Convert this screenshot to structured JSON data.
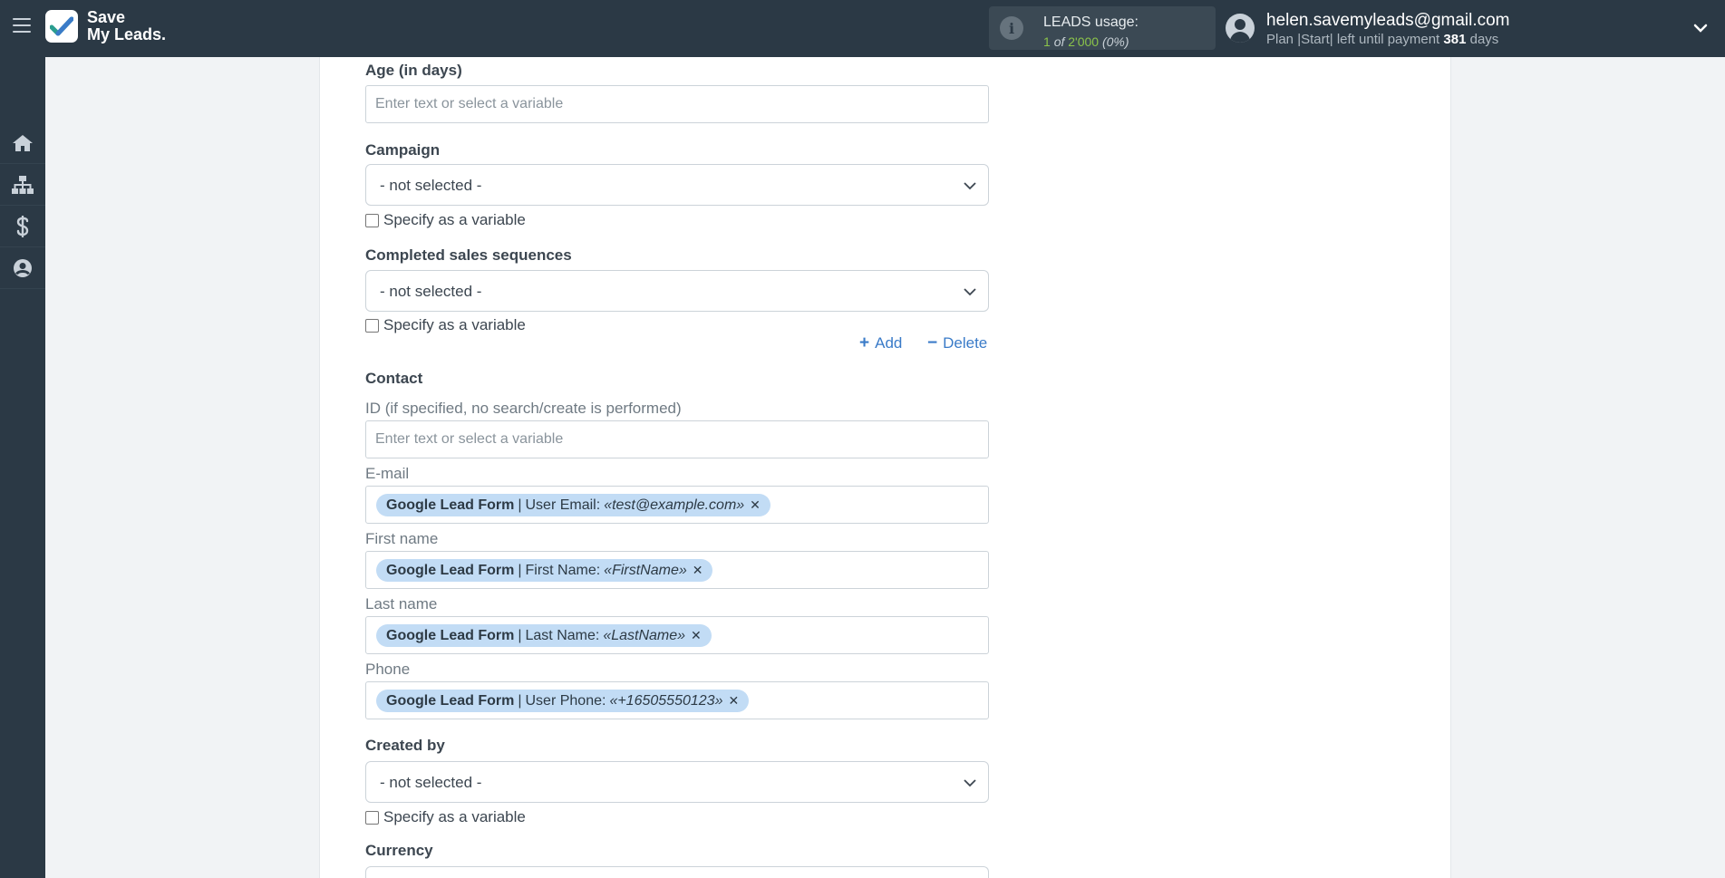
{
  "header": {
    "brand_line1": "Save",
    "brand_line2": "My Leads.",
    "usage_title": "LEADS usage:",
    "usage_used": "1",
    "usage_of": "of",
    "usage_total": "2'000",
    "usage_percent": "(0%)",
    "user_email": "helen.savemyleads@gmail.com",
    "plan_text": "Plan |Start| left until payment",
    "plan_days": "381",
    "plan_days_unit": "days"
  },
  "sidebar": {
    "items": [
      {
        "icon": "home-icon"
      },
      {
        "icon": "sitemap-icon"
      },
      {
        "icon": "dollar-icon"
      },
      {
        "icon": "account-icon"
      }
    ]
  },
  "form": {
    "age_label": "Age (in days)",
    "age_placeholder": "Enter text or select a variable",
    "campaign_label": "Campaign",
    "campaign_value": "- not selected -",
    "campaign_specify": "Specify as a variable",
    "sequences_label": "Completed sales sequences",
    "sequences_value": "- not selected -",
    "sequences_specify": "Specify as a variable",
    "add_label": "Add",
    "delete_label": "Delete",
    "contact_label": "Contact",
    "id_label": "ID (if specified, no search/create is performed)",
    "id_placeholder": "Enter text or select a variable",
    "email_label": "E-mail",
    "email_tag": {
      "source": "Google Lead Form",
      "field": "User Email:",
      "example": "«test@example.com»"
    },
    "first_label": "First name",
    "first_tag": {
      "source": "Google Lead Form",
      "field": "First Name:",
      "example": "«FirstName»"
    },
    "last_label": "Last name",
    "last_tag": {
      "source": "Google Lead Form",
      "field": "Last Name:",
      "example": "«LastName»"
    },
    "phone_label": "Phone",
    "phone_tag": {
      "source": "Google Lead Form",
      "field": "User Phone:",
      "example": "«+16505550123»"
    },
    "created_label": "Created by",
    "created_value": "- not selected -",
    "created_specify": "Specify as a variable",
    "currency_label": "Currency"
  },
  "colors": {
    "topbar": "#2b3945",
    "accent_link": "#3a7bc8",
    "tag_bg": "#c2dcf5",
    "usage_green": "#8bc34a"
  }
}
